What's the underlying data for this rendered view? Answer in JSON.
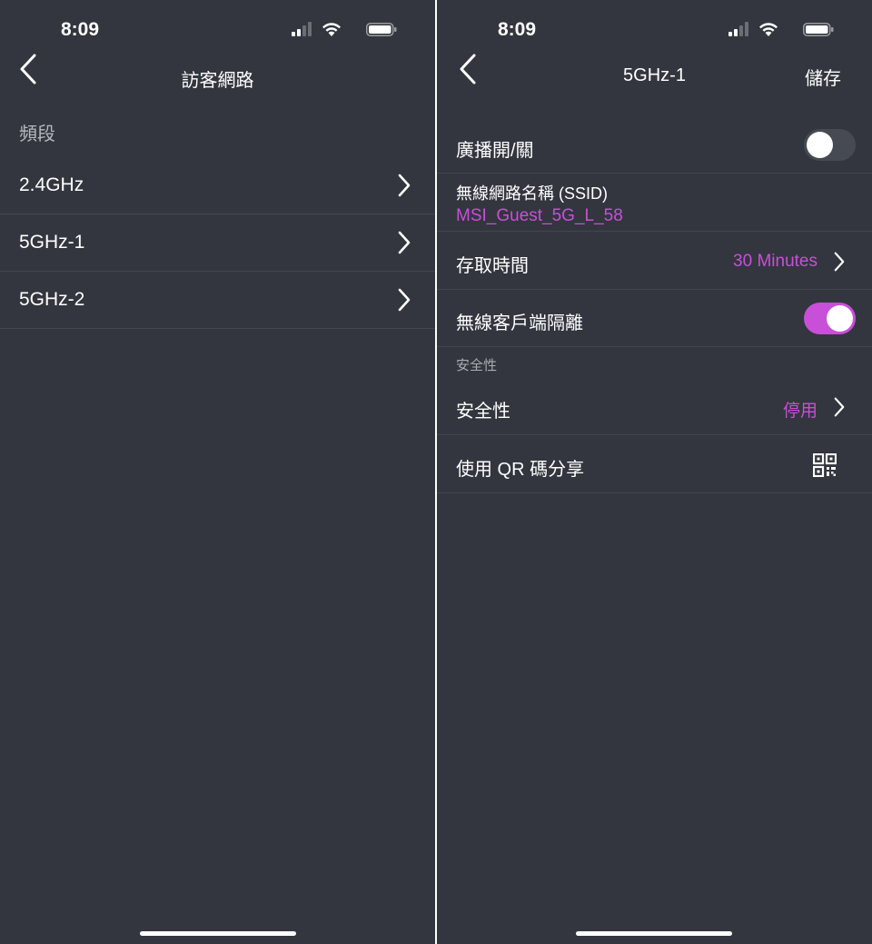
{
  "left_screen": {
    "status": {
      "time": "8:09"
    },
    "header": {
      "title": "訪客網路"
    },
    "section_label": "頻段",
    "bands": [
      {
        "label": "2.4GHz"
      },
      {
        "label": "5GHz-1"
      },
      {
        "label": "5GHz-2"
      }
    ]
  },
  "right_screen": {
    "status": {
      "time": "8:09"
    },
    "header": {
      "title": "5GHz-1",
      "save_label": "儲存"
    },
    "broadcast": {
      "label": "廣播開/關",
      "enabled": false
    },
    "ssid": {
      "label": "無線網路名稱 (SSID)",
      "value": "MSI_Guest_5G_L_58"
    },
    "access_time": {
      "label": "存取時間",
      "value": "30 Minutes"
    },
    "client_isolation": {
      "label": "無線客戶端隔離",
      "enabled": true
    },
    "security_section_label": "安全性",
    "security": {
      "label": "安全性",
      "value": "停用"
    },
    "qr_share": {
      "label": "使用 QR 碼分享"
    }
  },
  "colors": {
    "background": "#33363e",
    "accent": "#c84fd8",
    "divider": "#43464e",
    "text": "#ffffff",
    "muted_text": "#b7b9bf"
  },
  "icons": [
    "back-arrow-icon",
    "chevron-right-icon",
    "signal-icon",
    "wifi-icon",
    "battery-icon",
    "qr-code-icon"
  ]
}
